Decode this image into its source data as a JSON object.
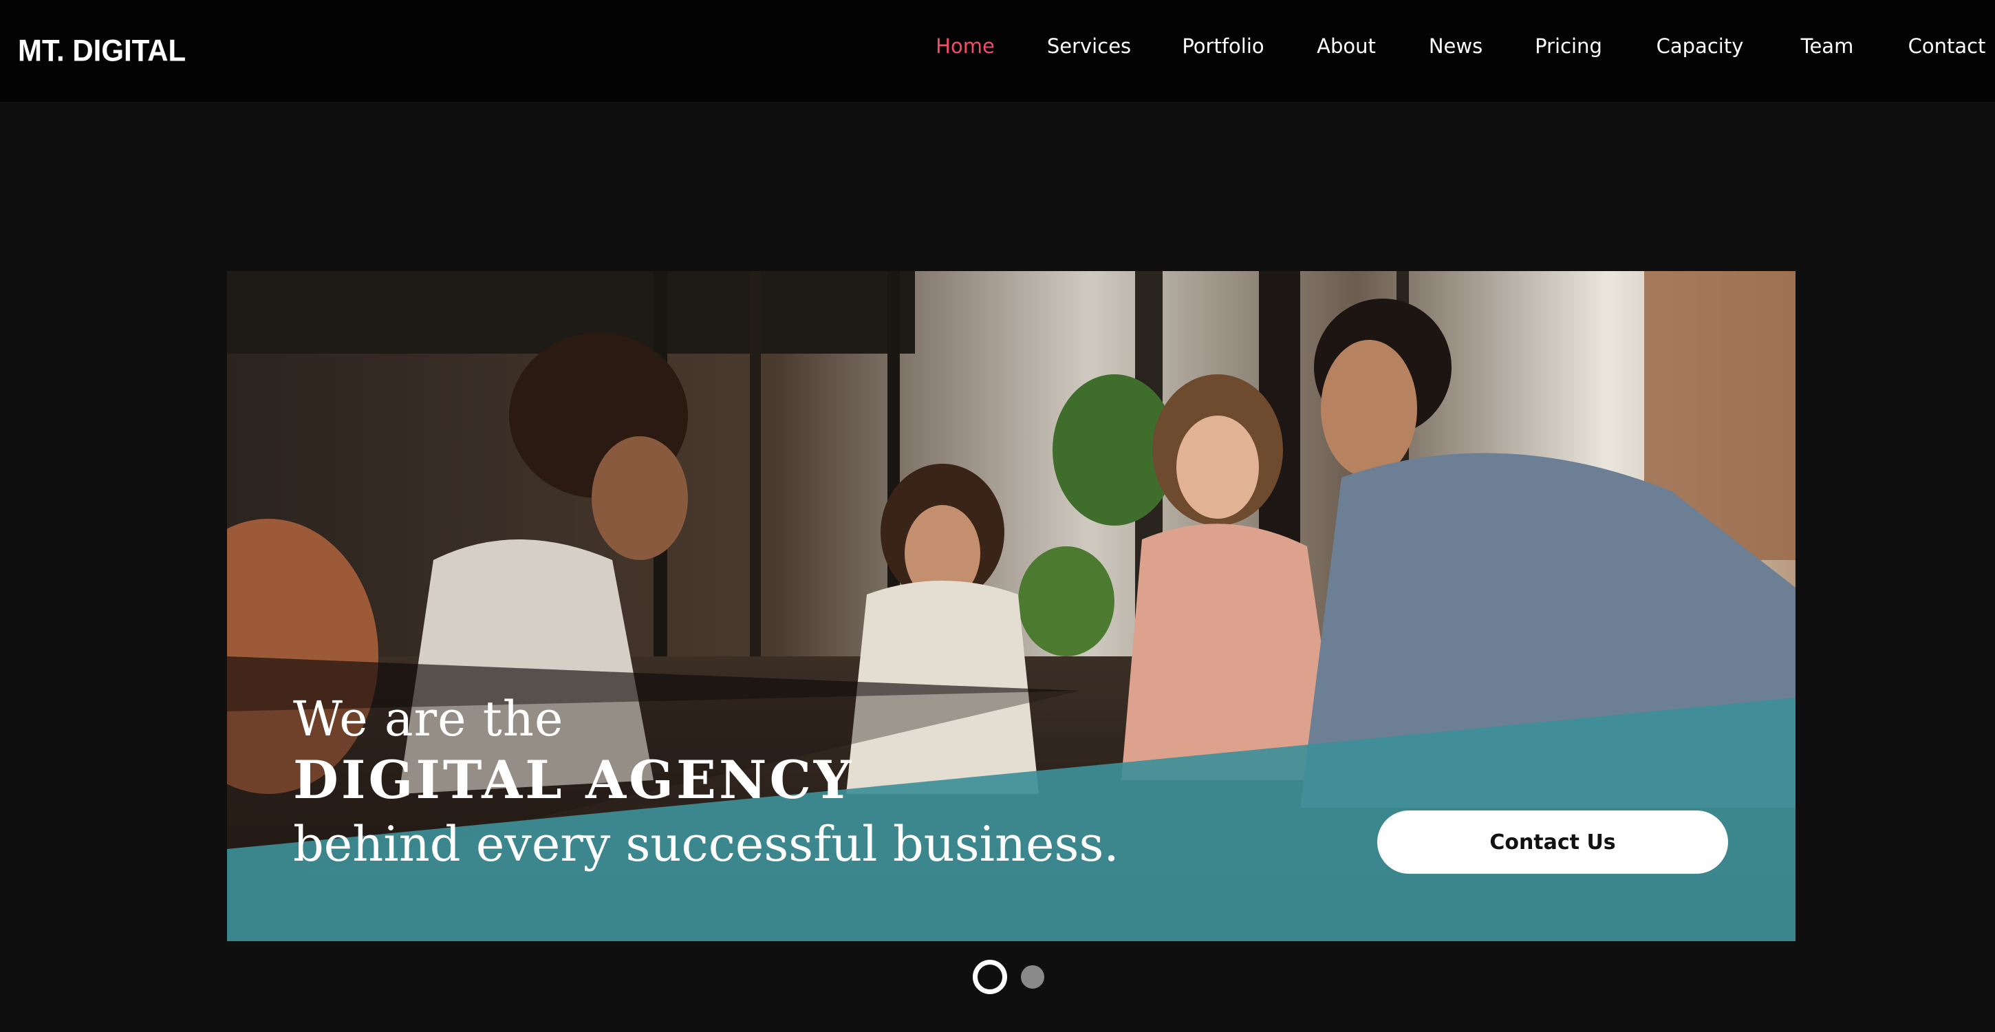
{
  "header": {
    "logo": "MT. DIGITAL",
    "nav": [
      {
        "label": "Home",
        "active": true
      },
      {
        "label": "Services"
      },
      {
        "label": "Portfolio"
      },
      {
        "label": "About"
      },
      {
        "label": "News"
      },
      {
        "label": "Pricing"
      },
      {
        "label": "Capacity"
      },
      {
        "label": "Team"
      },
      {
        "label": "Contact"
      }
    ]
  },
  "hero": {
    "line1": "We are the",
    "line2": "DIGITAL AGENCY",
    "line3": "behind every successful business.",
    "cta_label": "Contact Us",
    "image": "office-team-photo"
  },
  "carousel": {
    "slide_count": 2,
    "active_slide": 1
  },
  "colors": {
    "background": "#0f0f0f",
    "header_background": "#030303",
    "active_nav": "#ef4d6b",
    "banner_teal": "#3e8f98",
    "cta_background": "#ffffff"
  }
}
